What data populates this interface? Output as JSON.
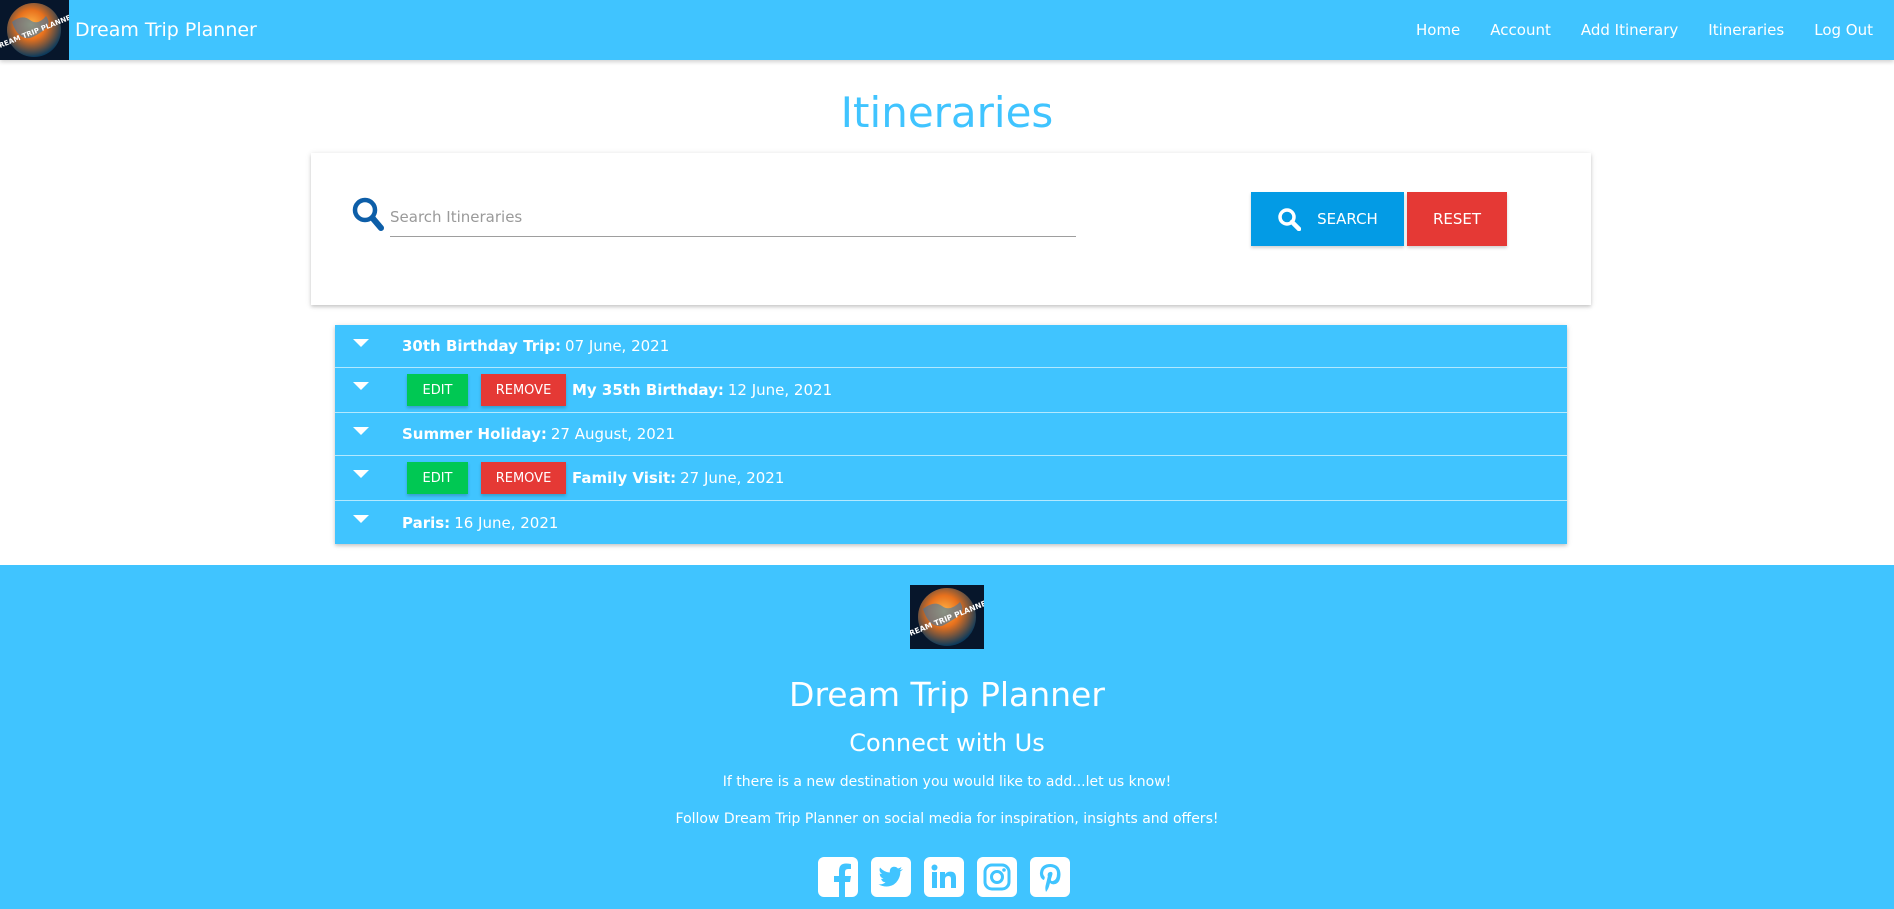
{
  "brand": {
    "name": "Dream Trip Planner",
    "logo_icon": "globe-logo-icon",
    "logo_text": "DREAM TRIP PLANNER"
  },
  "nav": {
    "links": [
      {
        "label": "Home"
      },
      {
        "label": "Account"
      },
      {
        "label": "Add Itinerary"
      },
      {
        "label": "Itineraries"
      },
      {
        "label": "Log Out"
      }
    ]
  },
  "page": {
    "title": "Itineraries"
  },
  "search": {
    "placeholder": "Search Itineraries",
    "value": "",
    "search_label": "Search",
    "reset_label": "Reset"
  },
  "itineraries": [
    {
      "name": "30th Birthday Trip:",
      "date": "07 June, 2021",
      "editable": false
    },
    {
      "name": "My 35th Birthday:",
      "date": "12 June, 2021",
      "editable": true,
      "edit_label": "Edit",
      "remove_label": "Remove"
    },
    {
      "name": "Summer Holiday:",
      "date": "27 August, 2021",
      "editable": false
    },
    {
      "name": "Family Visit:",
      "date": "27 June, 2021",
      "editable": true,
      "edit_label": "Edit",
      "remove_label": "Remove"
    },
    {
      "name": "Paris:",
      "date": "16 June, 2021",
      "editable": false
    }
  ],
  "footer": {
    "title": "Dream Trip Planner",
    "subtitle": "Connect with Us",
    "text1": "If there is a new destination you would like to add...let us know!",
    "text2": "Follow Dream Trip Planner on social media for inspiration, insights and offers!",
    "social": [
      "facebook-icon",
      "twitter-icon",
      "linkedin-icon",
      "instagram-icon",
      "pinterest-icon"
    ]
  },
  "colors": {
    "primary": "#40c4ff",
    "search_button": "#039be5",
    "danger": "#e53935",
    "success": "#00c853"
  }
}
